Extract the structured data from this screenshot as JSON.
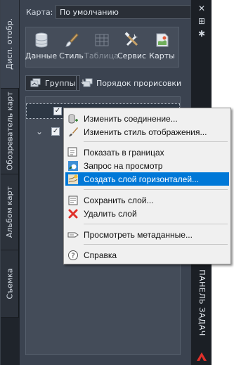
{
  "left_tabs": [
    "Дисп. отобр.",
    "Обозреватель карт",
    "Альбом карт",
    "Съемка"
  ],
  "map": {
    "label": "Карта:",
    "value": "По умолчанию"
  },
  "ribbon": {
    "buttons": [
      {
        "label": "Данные",
        "icon": "database-icon",
        "enabled": true
      },
      {
        "label": "Стиль",
        "icon": "brush-icon",
        "enabled": true
      },
      {
        "label": "Таблица",
        "icon": "table-icon",
        "enabled": false
      },
      {
        "label": "Сервис",
        "icon": "tools-icon",
        "enabled": true
      },
      {
        "label": "Карты",
        "icon": "map-icon",
        "enabled": true
      }
    ]
  },
  "toolbar": {
    "groups_label": "Группы",
    "draw_order_label": "Порядок прорисовки"
  },
  "layers": [
    {
      "checked": true,
      "selected": true
    },
    {
      "checked": true,
      "selected": false
    }
  ],
  "context_menu": {
    "items": [
      {
        "label": "Изменить соединение...",
        "icon": "data-connect-icon",
        "hovered": false
      },
      {
        "label": "Изменить стиль отображения...",
        "icon": "brush-icon",
        "hovered": false
      },
      {
        "label": "Показать в границах",
        "icon": "zoom-extents-icon",
        "hovered": false
      },
      {
        "label": "Запрос на просмотр",
        "icon": "query-icon",
        "hovered": false
      },
      {
        "label": "Создать слой горизонталей...",
        "icon": "contour-icon",
        "hovered": true
      },
      {
        "label": "Сохранить слой...",
        "icon": "save-icon",
        "hovered": false
      },
      {
        "label": "Удалить слой",
        "icon": "delete-icon",
        "hovered": false
      },
      {
        "label": "Просмотреть метаданные...",
        "icon": "metadata-icon",
        "hovered": false
      },
      {
        "label": "Справка",
        "icon": "help-icon",
        "hovered": false
      }
    ]
  },
  "task_pane_title": "ПАНЕЛЬ ЗАДАЧ",
  "colors": {
    "accent": "#0078d7",
    "panel_bg": "#3b4350",
    "delete_red": "#e0302a"
  }
}
